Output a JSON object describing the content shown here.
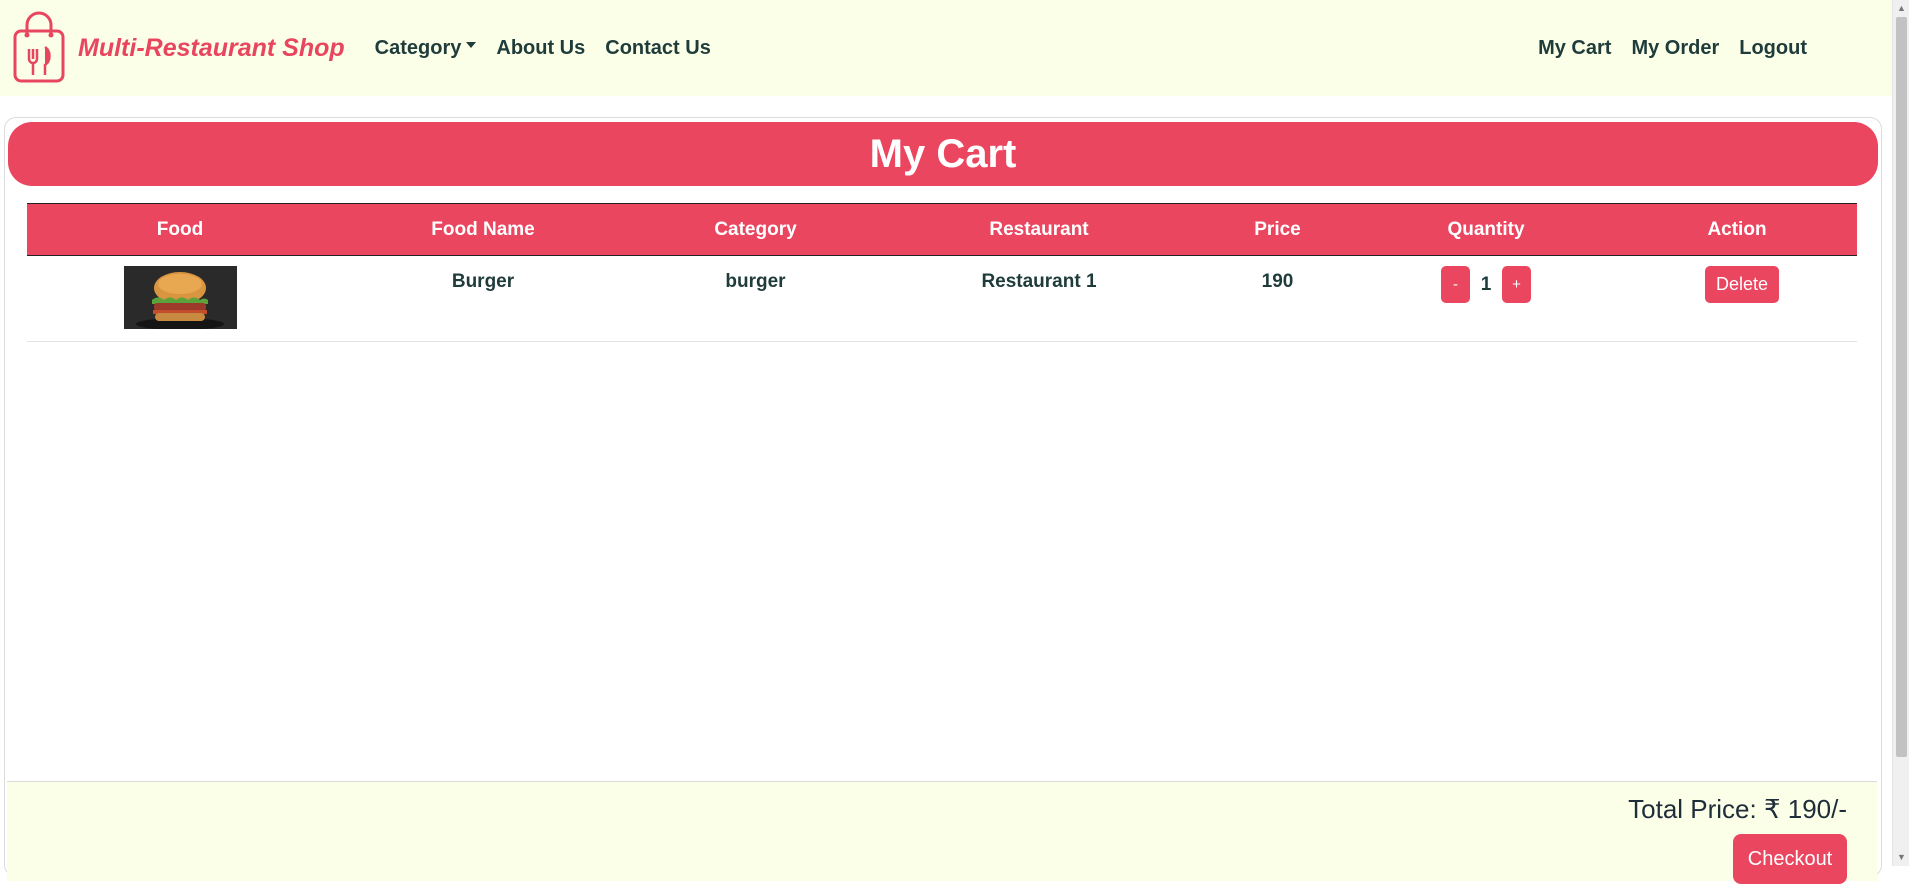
{
  "brand": {
    "name": "Multi-Restaurant Shop",
    "color": "#e8465f"
  },
  "nav": {
    "left": [
      {
        "label": "Category",
        "dropdown": true
      },
      {
        "label": "About Us"
      },
      {
        "label": "Contact Us"
      }
    ],
    "right": [
      {
        "label": "My Cart"
      },
      {
        "label": "My Order"
      },
      {
        "label": "Logout"
      }
    ]
  },
  "page_title": "My Cart",
  "table": {
    "headers": [
      "Food",
      "Food Name",
      "Category",
      "Restaurant",
      "Price",
      "Quantity",
      "Action"
    ],
    "rows": [
      {
        "image_icon": "burger-photo",
        "name": "Burger",
        "category": "burger",
        "restaurant": "Restaurant 1",
        "price": "190",
        "quantity": "1",
        "decrement_label": "-",
        "increment_label": "+",
        "delete_label": "Delete"
      }
    ]
  },
  "footer": {
    "total": "Total Price: ₹ 190/-",
    "checkout_label": "Checkout"
  },
  "colors": {
    "accent": "#ea4660",
    "navbar_bg": "#fbffe8",
    "text": "#1f3b3a"
  }
}
